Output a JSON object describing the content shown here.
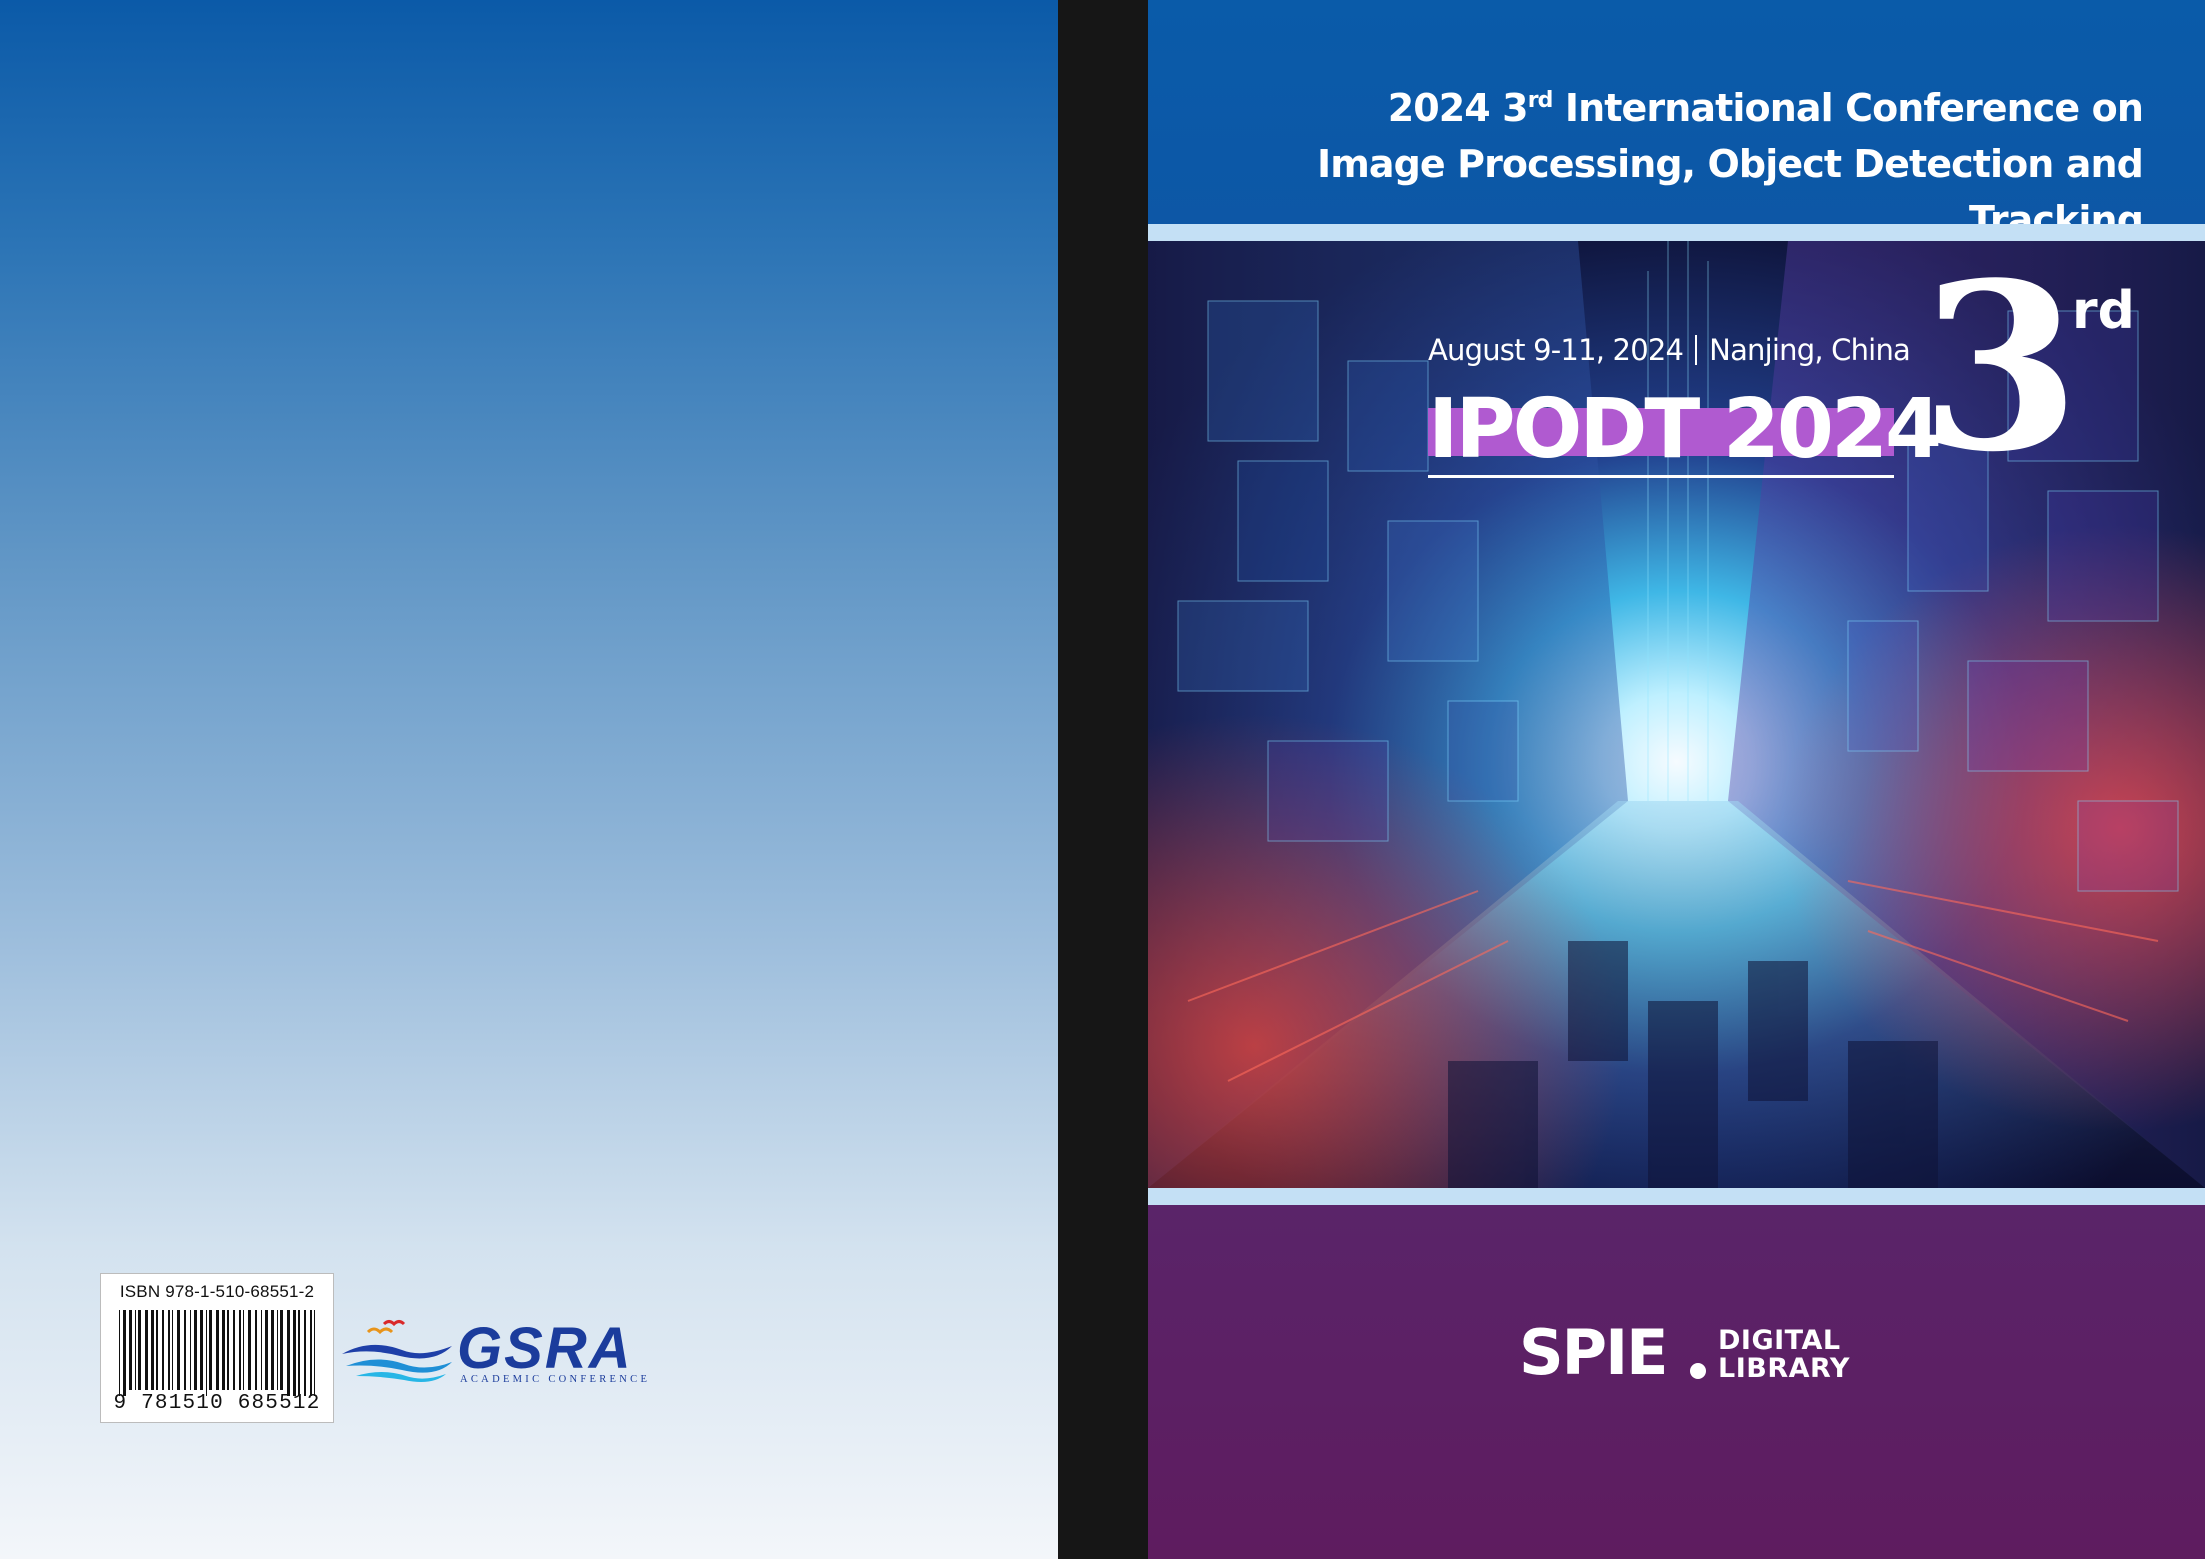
{
  "back_cover": {
    "isbn_label": "ISBN 978-1-510-68551-2",
    "barcode_digits": "9 781510 685512",
    "publisher_logo": {
      "word": "GSRA",
      "tagline": "ACADEMIC CONFERENCE"
    }
  },
  "front_cover": {
    "title": {
      "year_prefix": "2024 3",
      "ordinal": "rd",
      "line1_rest": " International Conference on",
      "line2": "Image Processing, Object Detection and Tracking"
    },
    "event": {
      "dates": "August 9-11, 2024",
      "location": "Nanjing, China"
    },
    "acronym": "IPODT 2024",
    "edition": {
      "number": "3",
      "suffix": "rd"
    },
    "publisher": {
      "name": "SPIE",
      "sub_line1": "DIGITAL",
      "sub_line2": "LIBRARY"
    }
  },
  "colors": {
    "header_blue": "#0a5ba9",
    "stripe_light_blue": "#c4e0f5",
    "footer_purple": "#5b2264",
    "acronym_highlight": "#b05ad0",
    "spine": "#161616"
  }
}
